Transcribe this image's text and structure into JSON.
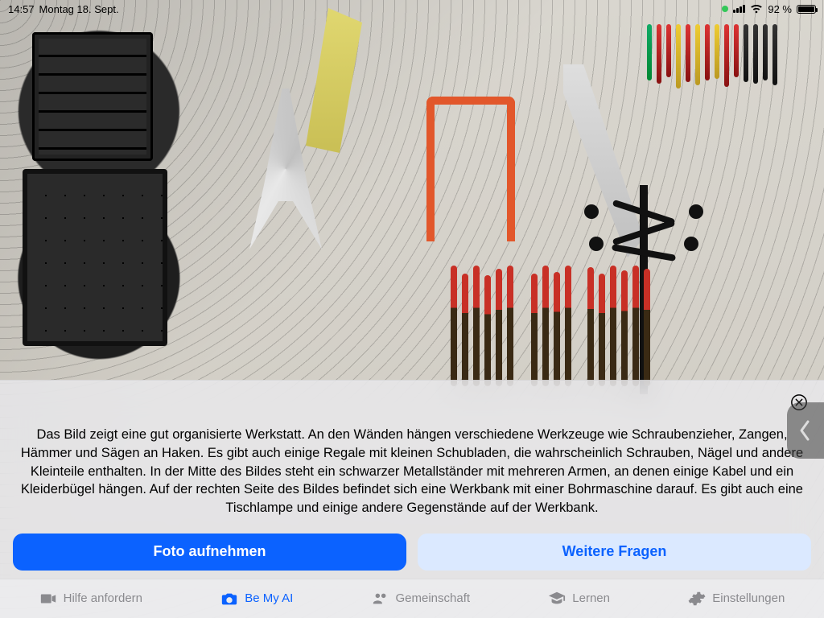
{
  "status": {
    "time": "14:57",
    "date": "Montag 18. Sept.",
    "battery_pct": "92 %",
    "wifi_icon": "wifi",
    "signal_icon": "cellular",
    "location_indicator": true
  },
  "photo": {
    "alt": "Werkstatt-Wand mit Werkzeugen an Lochwand, Schubladenmagazin links, Ständer rechts"
  },
  "sheet": {
    "close_label": "Schließen",
    "description": "Das Bild zeigt eine gut organisierte Werkstatt. An den Wänden hängen verschiedene Werkzeuge wie Schraubenzieher, Zangen, Hämmer und Sägen an Haken. Es gibt auch einige Regale mit kleinen Schubladen, die wahrscheinlich Schrauben, Nägel und andere Kleinteile enthalten. In der Mitte des Bildes steht ein schwarzer Metallständer mit mehreren Armen, an denen einige Kabel und ein Kleiderbügel hängen. Auf der rechten Seite des Bildes befindet sich eine Werkbank mit einer Bohrmaschine darauf. Es gibt auch eine Tischlampe und einige andere Gegenstände auf der Werkbank.",
    "primary_button": "Foto aufnehmen",
    "secondary_button": "Weitere Fragen"
  },
  "tabs": [
    {
      "id": "help",
      "label": "Hilfe anfordern",
      "icon": "video",
      "active": false
    },
    {
      "id": "bemyai",
      "label": "Be My AI",
      "icon": "camera",
      "active": true
    },
    {
      "id": "community",
      "label": "Gemeinschaft",
      "icon": "people",
      "active": false
    },
    {
      "id": "learn",
      "label": "Lernen",
      "icon": "grad-cap",
      "active": false
    },
    {
      "id": "settings",
      "label": "Einstellungen",
      "icon": "gear",
      "active": false
    }
  ]
}
